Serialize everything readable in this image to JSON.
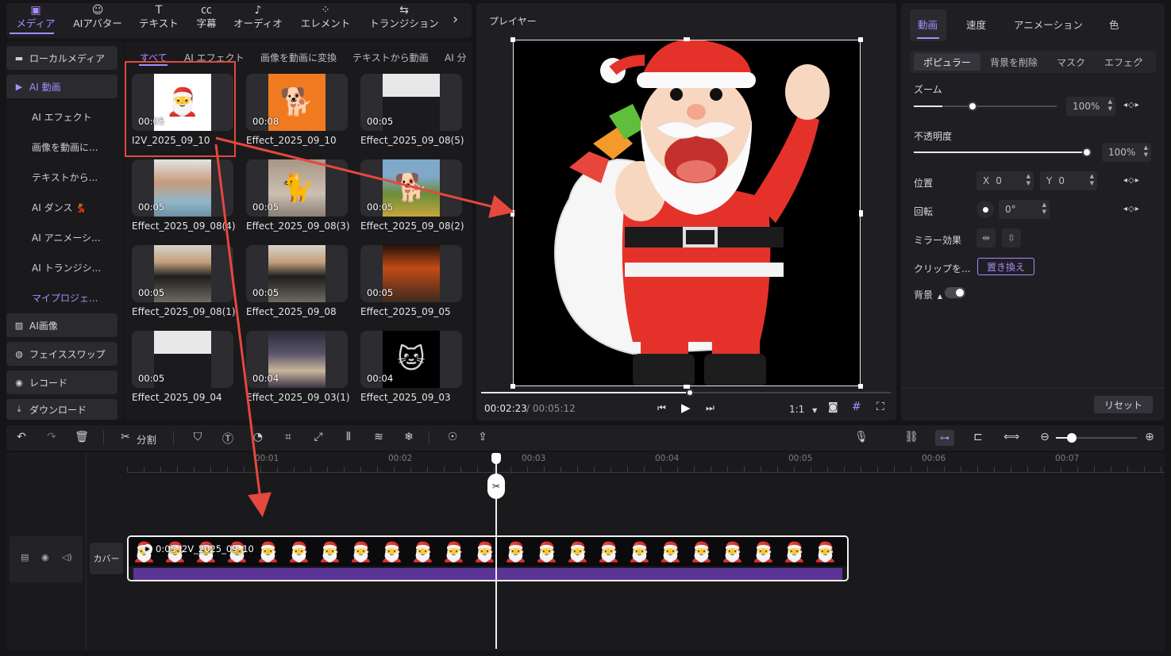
{
  "top_toolbar": {
    "items": [
      {
        "label": "メディア",
        "icon": "media-icon"
      },
      {
        "label": "AIアバター",
        "icon": "avatar-icon"
      },
      {
        "label": "テキスト",
        "icon": "text-icon"
      },
      {
        "label": "字幕",
        "icon": "caption-icon"
      },
      {
        "label": "オーディオ",
        "icon": "music-icon"
      },
      {
        "label": "エレメント",
        "icon": "element-icon"
      },
      {
        "label": "トランジション",
        "icon": "transition-icon"
      }
    ],
    "active_index": 0,
    "accent": "#a98bff"
  },
  "left_nav": {
    "local_media": "ローカルメディア",
    "ai_video": "AI 動画",
    "sub_items": [
      "AI エフェクト",
      "画像を動画に...",
      "テキストから...",
      "AI ダンス",
      "AI アニメーシ...",
      "AI トランジシ...",
      "マイプロジェ..."
    ],
    "dance_emoji": "💃",
    "ai_image": "AI画像",
    "face_swap": "フェイススワップ",
    "record": "レコード",
    "download": "ダウンロード"
  },
  "media_tabs": [
    "すべて",
    "AI エフェクト",
    "画像を動画に変換",
    "テキストから動画",
    "AI 分"
  ],
  "media_items": [
    {
      "duration": "00:05",
      "name": "I2V_2025_09_10",
      "thumb": "santa"
    },
    {
      "duration": "00:08",
      "name": "Effect_2025_09_10",
      "thumb": "corgi"
    },
    {
      "duration": "00:05",
      "name": "Effect_2025_09_08(5)",
      "thumb": "man-suit"
    },
    {
      "duration": "00:05",
      "name": "Effect_2025_09_08(4)",
      "thumb": "man-curly"
    },
    {
      "duration": "00:05",
      "name": "Effect_2025_09_08(3)",
      "thumb": "cat"
    },
    {
      "duration": "00:05",
      "name": "Effect_2025_09_08(2)",
      "thumb": "dog-field"
    },
    {
      "duration": "00:05",
      "name": "Effect_2025_09_08(1)",
      "thumb": "man-vest"
    },
    {
      "duration": "00:05",
      "name": "Effect_2025_09_08",
      "thumb": "man-vest"
    },
    {
      "duration": "00:05",
      "name": "Effect_2025_09_05",
      "thumb": "boy-orange"
    },
    {
      "duration": "00:05",
      "name": "Effect_2025_09_04",
      "thumb": "man-suit"
    },
    {
      "duration": "00:04",
      "name": "Effect_2025_09_03(1)",
      "thumb": "party"
    },
    {
      "duration": "00:04",
      "name": "Effect_2025_09_03",
      "thumb": "doraemon"
    }
  ],
  "player": {
    "title": "プレイヤー",
    "current_time": "00:02:23",
    "total_time": "/ 00:05:12",
    "ratio": "1:1",
    "progress": 0.51
  },
  "properties": {
    "tabs": [
      "動画",
      "速度",
      "アニメーション",
      "色"
    ],
    "sub_tabs": [
      "ポピュラー",
      "背景を削除",
      "マスク",
      "エフェクト"
    ],
    "zoom_label": "ズーム",
    "zoom_value": "100%",
    "zoom_level": 0.2,
    "opacity_label": "不透明度",
    "opacity_value": "100%",
    "opacity_level": 1.0,
    "position_label": "位置",
    "pos_x_label": "X",
    "pos_x": "0",
    "pos_y_label": "Y",
    "pos_y": "0",
    "rotation_label": "回転",
    "rotation_value": "0°",
    "mirror_label": "ミラー効果",
    "clip_label": "クリップを...",
    "replace_button": "置き換え",
    "background_label": "背景",
    "reset_button": "リセット"
  },
  "timeline_toolbar": {
    "split_label": "分割"
  },
  "timeline": {
    "ruler_labels": [
      "00:01",
      "00:02",
      "00:03",
      "00:04",
      "00:05",
      "00:06",
      "00:07"
    ],
    "cover_label": "カバー",
    "clip_duration": "0:05",
    "clip_name": "I2V_2025_09_10",
    "clip_audio_color": "#5a3596"
  },
  "annotation_color": "#e5483d"
}
